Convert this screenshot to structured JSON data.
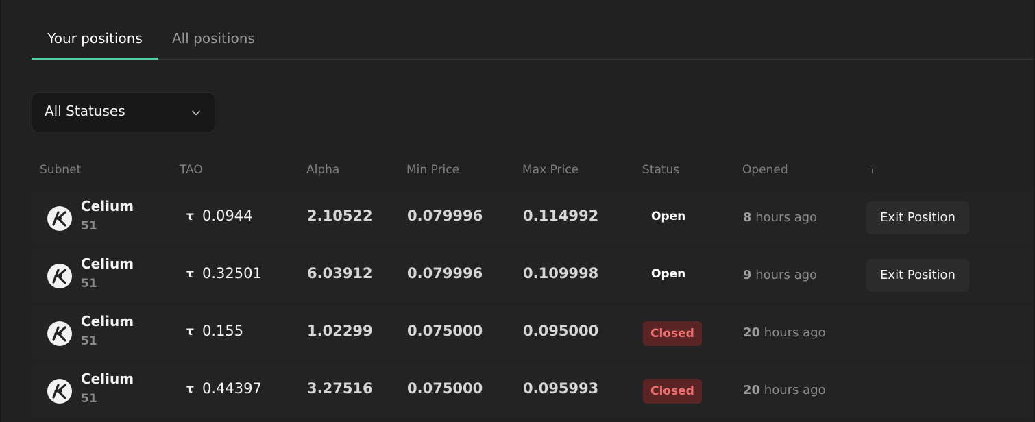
{
  "tabs": [
    {
      "label": "Your positions",
      "active": true
    },
    {
      "label": "All positions",
      "active": false
    }
  ],
  "filter": {
    "selected": "All Statuses",
    "icon": "chevron-down-icon"
  },
  "table": {
    "columns": [
      "Subnet",
      "TAO",
      "Alpha",
      "Min Price",
      "Max Price",
      "Status",
      "Opened"
    ],
    "rows": [
      {
        "subnet_name": "Celium",
        "subnet_id": "51",
        "tao_symbol": "τ",
        "tao": "0.0944",
        "alpha": "2.10522",
        "min_price": "0.079996",
        "max_price": "0.114992",
        "status": "Open",
        "opened_num": "8",
        "opened_unit": "hours ago",
        "action": "Exit Position"
      },
      {
        "subnet_name": "Celium",
        "subnet_id": "51",
        "tao_symbol": "τ",
        "tao": "0.32501",
        "alpha": "6.03912",
        "min_price": "0.079996",
        "max_price": "0.109998",
        "status": "Open",
        "opened_num": "9",
        "opened_unit": "hours ago",
        "action": "Exit Position"
      },
      {
        "subnet_name": "Celium",
        "subnet_id": "51",
        "tao_symbol": "τ",
        "tao": "0.155",
        "alpha": "1.02299",
        "min_price": "0.075000",
        "max_price": "0.095000",
        "status": "Closed",
        "opened_num": "20",
        "opened_unit": "hours ago"
      },
      {
        "subnet_name": "Celium",
        "subnet_id": "51",
        "tao_symbol": "τ",
        "tao": "0.44397",
        "alpha": "3.27516",
        "min_price": "0.075000",
        "max_price": "0.095993",
        "status": "Closed",
        "opened_num": "20",
        "opened_unit": "hours ago"
      }
    ]
  },
  "colors": {
    "background": "#212121",
    "accent": "#4fd1a5",
    "closed_badge_bg": "#5a2424",
    "closed_badge_text": "#ef6f6f"
  }
}
